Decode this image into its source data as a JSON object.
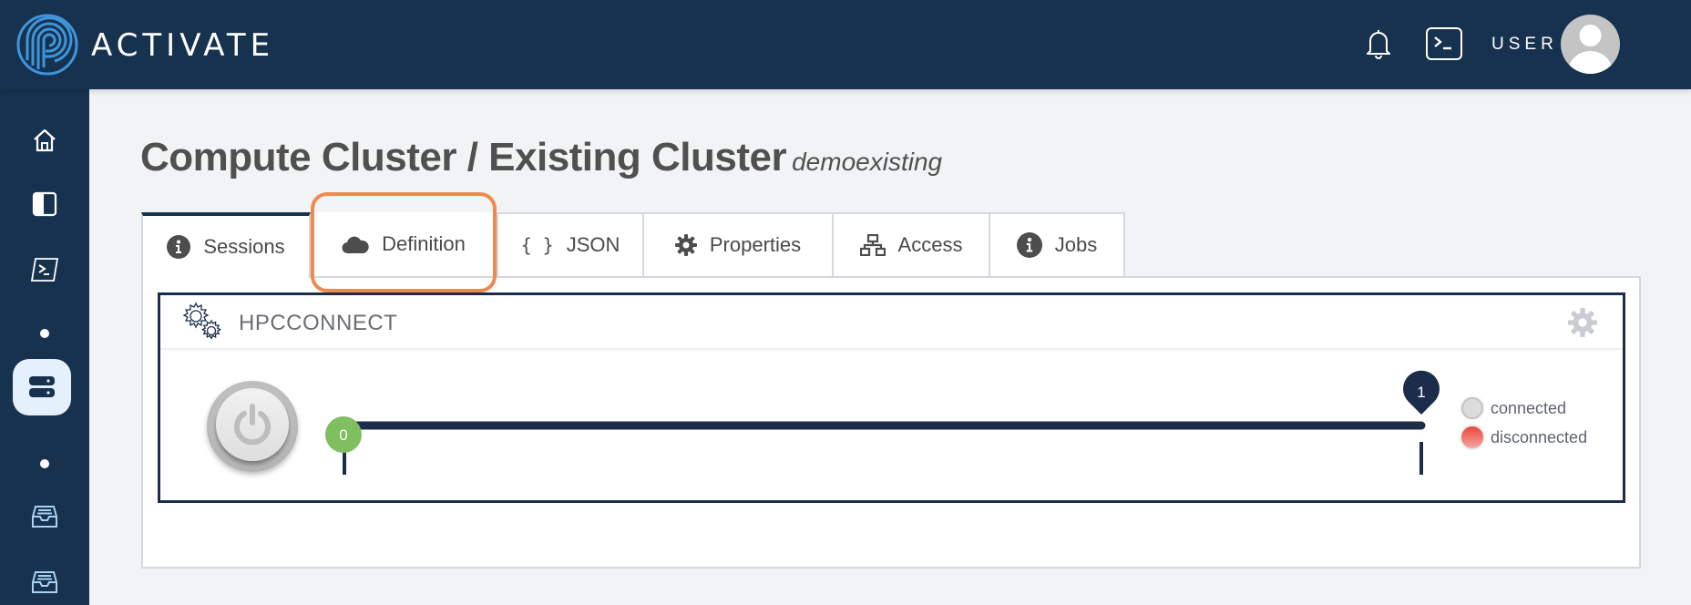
{
  "header": {
    "brand": "ACTIVATE",
    "user_label": "USER",
    "icons": [
      "logo-icon",
      "bell-icon",
      "terminal-icon",
      "avatar-icon"
    ]
  },
  "sidebar": {
    "items": [
      {
        "name": "home",
        "icon": "home-icon"
      },
      {
        "name": "panel",
        "icon": "split-panel-icon"
      },
      {
        "name": "terminal",
        "icon": "terminal-icon"
      },
      {
        "name": "dot-1",
        "icon": "dot-icon"
      },
      {
        "name": "compute",
        "icon": "server-icon",
        "active": true
      },
      {
        "name": "dot-2",
        "icon": "dot-icon"
      },
      {
        "name": "storage-1",
        "icon": "inbox-icon"
      },
      {
        "name": "storage-2",
        "icon": "inbox-icon"
      }
    ]
  },
  "page": {
    "title": "Compute Cluster / Existing Cluster",
    "subtitle": "demoexisting"
  },
  "tabs": [
    {
      "label": "Sessions",
      "icon": "info-icon",
      "active": true
    },
    {
      "label": "Definition",
      "icon": "cloud-icon",
      "highlighted": true
    },
    {
      "label": "JSON",
      "icon": "braces-icon"
    },
    {
      "label": "Properties",
      "icon": "gear-icon"
    },
    {
      "label": "Access",
      "icon": "network-icon"
    },
    {
      "label": "Jobs",
      "icon": "info-icon"
    }
  ],
  "card": {
    "title": "HPCCONNECT",
    "track": {
      "start_node": "0",
      "end_node": "1"
    },
    "legend": [
      {
        "label": "connected",
        "color": "#dcdcdc"
      },
      {
        "label": "disconnected",
        "color": "#e9463c"
      }
    ]
  },
  "colors": {
    "navy": "#17324f",
    "accent_orange": "#ee8a50",
    "node_green": "#7fbf60"
  }
}
